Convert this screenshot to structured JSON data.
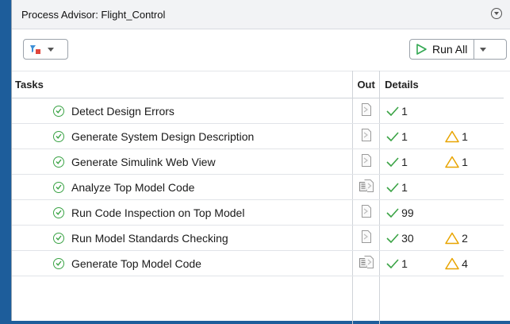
{
  "window": {
    "title": "Process Advisor: Flight_Control"
  },
  "toolbar": {
    "run_all_label": "Run All"
  },
  "table": {
    "headers": {
      "tasks": "Tasks",
      "out": "Out",
      "details": "Details"
    },
    "rows": [
      {
        "task": "Detect Design Errors",
        "out_icon": "report-icon",
        "pass": "1",
        "warn": ""
      },
      {
        "task": "Generate System Design Description",
        "out_icon": "report-icon",
        "pass": "1",
        "warn": "1"
      },
      {
        "task": "Generate Simulink Web View",
        "out_icon": "report-icon",
        "pass": "1",
        "warn": "1"
      },
      {
        "task": "Analyze Top Model Code",
        "out_icon": "code-report-icon",
        "pass": "1",
        "warn": ""
      },
      {
        "task": "Run Code Inspection on Top Model",
        "out_icon": "report-icon",
        "pass": "99",
        "warn": ""
      },
      {
        "task": "Run Model Standards Checking",
        "out_icon": "report-icon",
        "pass": "30",
        "warn": "2"
      },
      {
        "task": "Generate Top Model Code",
        "out_icon": "code-report-icon",
        "pass": "1",
        "warn": "4"
      }
    ]
  },
  "colors": {
    "pass": "#3aa345",
    "warn": "#e8a400",
    "run_green": "#34a853",
    "window_bg": "#1d5d9b"
  }
}
